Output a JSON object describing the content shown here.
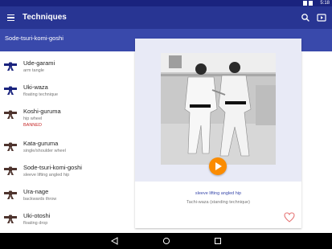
{
  "status_bar": {
    "time": "5:18"
  },
  "app_bar": {
    "title": "Techniques"
  },
  "sub_bar": {
    "title": "Sode-tsuri-komi-goshi"
  },
  "techniques": [
    {
      "name": "Ude-garami",
      "translation": "arm tangle",
      "belt_color": "#1a237e",
      "banned": ""
    },
    {
      "name": "Uki-waza",
      "translation": "floating technique",
      "belt_color": "#1a237e",
      "banned": ""
    },
    {
      "name": "Koshi-guruma",
      "translation": "hip wheel",
      "belt_color": "#4e342e",
      "banned": "BANNED"
    },
    {
      "name": "Kata-guruma",
      "translation": "single/shoulder wheel",
      "belt_color": "#4e342e",
      "banned": ""
    },
    {
      "name": "Sode-tsuri-komi-goshi",
      "translation": "sleeve lifting angled hip",
      "belt_color": "#4e342e",
      "banned": ""
    },
    {
      "name": "Ura-nage",
      "translation": "backwards throw",
      "belt_color": "#4e342e",
      "banned": ""
    },
    {
      "name": "Uki-otoshi",
      "translation": "floating drop",
      "belt_color": "#4e342e",
      "banned": ""
    }
  ],
  "detail": {
    "translation": "sleeve lifting angled hip",
    "category": "Tachi-waza (standing technique)"
  },
  "colors": {
    "primary_dark": "#1a237e",
    "primary": "#283593",
    "primary_light": "#3949ab",
    "accent": "#fb8c00",
    "banned": "#c62828"
  },
  "icons": {
    "menu": "menu-icon",
    "search": "search-icon",
    "video": "video-icon",
    "play": "play-icon",
    "favorite": "heart-icon",
    "back": "back-icon",
    "home": "home-icon",
    "recents": "recents-icon"
  }
}
